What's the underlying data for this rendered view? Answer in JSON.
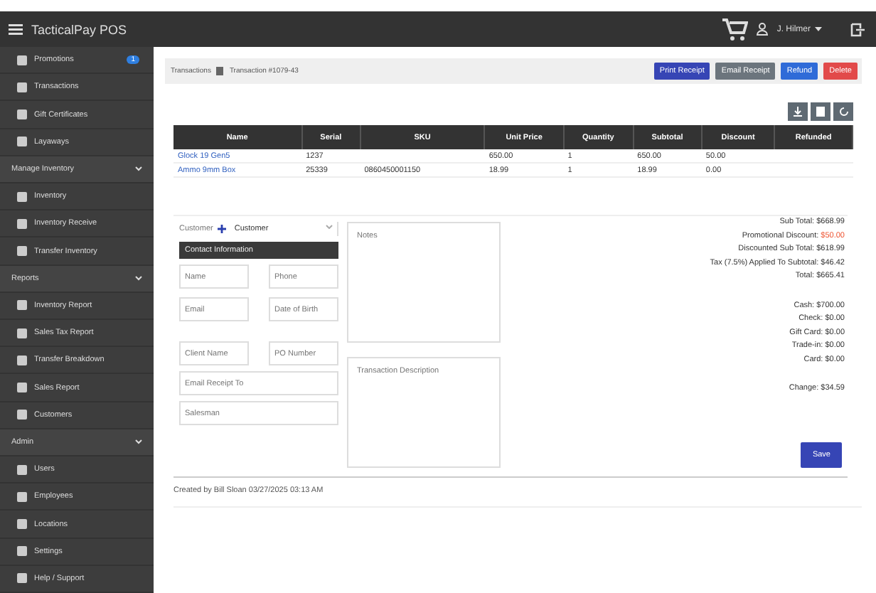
{
  "app": {
    "title": "TacticalPay POS",
    "user": "J. Hilmer"
  },
  "sidebar": [
    {
      "kind": "item",
      "label": "Promotions",
      "badge": "1"
    },
    {
      "kind": "item",
      "label": "Transactions"
    },
    {
      "kind": "item",
      "label": "Gift Certificates"
    },
    {
      "kind": "item",
      "label": "Layaways"
    },
    {
      "kind": "group",
      "label": "Manage Inventory",
      "expanded": true
    },
    {
      "kind": "item",
      "label": "Inventory"
    },
    {
      "kind": "item",
      "label": "Inventory Receive"
    },
    {
      "kind": "item",
      "label": "Transfer Inventory"
    },
    {
      "kind": "group",
      "label": "Reports",
      "expanded": true
    },
    {
      "kind": "item",
      "label": "Inventory Report"
    },
    {
      "kind": "item",
      "label": "Sales Tax Report"
    },
    {
      "kind": "item",
      "label": "Transfer Breakdown"
    },
    {
      "kind": "item",
      "label": "Sales Report"
    },
    {
      "kind": "item",
      "label": "Customers"
    },
    {
      "kind": "group",
      "label": "Admin",
      "expanded": true
    },
    {
      "kind": "item",
      "label": "Users"
    },
    {
      "kind": "item",
      "label": "Employees"
    },
    {
      "kind": "item",
      "label": "Locations"
    },
    {
      "kind": "item",
      "label": "Settings"
    },
    {
      "kind": "item",
      "label": "Help / Support"
    }
  ],
  "breadcrumb": [
    "Transactions",
    "Transaction #1079-43"
  ],
  "actions": [
    {
      "label": "Print Receipt",
      "kind": "primary"
    },
    {
      "label": "Email Receipt",
      "kind": "secondary"
    },
    {
      "label": "Refund",
      "kind": "info"
    },
    {
      "label": "Delete",
      "kind": "danger"
    }
  ],
  "table": {
    "columns": [
      "Name",
      "Serial",
      "SKU",
      "Unit Price",
      "Quantity",
      "Subtotal",
      "Discount",
      "Refunded"
    ],
    "rows": [
      [
        "Glock 19 Gen5",
        "1237",
        "",
        "650.00",
        "1",
        "650.00",
        "50.00",
        ""
      ],
      [
        "Ammo 9mm Box",
        "25339",
        "0860450001150",
        "18.99",
        "1",
        "18.99",
        "0.00",
        ""
      ]
    ]
  },
  "customer": {
    "label": "Customer",
    "select": "Customer",
    "contact_heading": "Contact Information",
    "fields": [
      {
        "placeholder": "Name"
      },
      {
        "placeholder": "Phone"
      },
      {
        "placeholder": "Email"
      },
      {
        "placeholder": "Date of Birth"
      }
    ],
    "fields2": [
      {
        "placeholder": "Client Name"
      },
      {
        "placeholder": "PO Number"
      },
      {
        "placeholder": "Email Receipt To"
      },
      {
        "placeholder": "Salesman"
      }
    ]
  },
  "notes": {
    "placeholder": "Notes"
  },
  "description": {
    "placeholder": "Transaction Description"
  },
  "save": "Save",
  "totals": [
    {
      "label": "Sub Total:",
      "value": "$668.99",
      "highlight": false
    },
    {
      "label": "Promotional Discount:",
      "value": "$50.00",
      "highlight": true
    },
    {
      "label": "Discounted Sub Total:",
      "value": "$618.99",
      "highlight": false
    },
    {
      "label": "Tax (7.5%) Applied To Subtotal:",
      "value": "$46.42",
      "highlight": false
    },
    {
      "label": "Total:",
      "value": "$665.41",
      "highlight": false
    }
  ],
  "payments": [
    {
      "label": "Cash:",
      "value": "$700.00"
    },
    {
      "label": "Check:",
      "value": "$0.00"
    },
    {
      "label": "Gift Card:",
      "value": "$0.00"
    },
    {
      "label": "Trade-in:",
      "value": "$0.00"
    },
    {
      "label": "Card:",
      "value": "$0.00"
    }
  ],
  "change": {
    "label": "Change:",
    "value": "$34.59"
  },
  "footer": "Created by Bill Sloan 03/27/2025 03:13 AM"
}
